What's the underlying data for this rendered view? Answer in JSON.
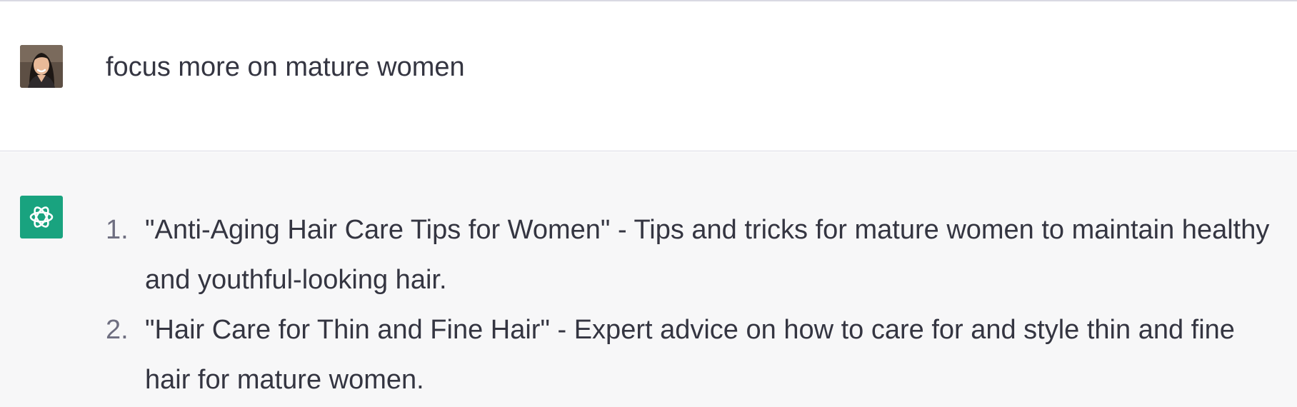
{
  "conversation": {
    "user_message": {
      "avatar_icon": "user-avatar-photo",
      "text": "focus more on mature women"
    },
    "assistant_message": {
      "avatar_icon": "openai-logo-icon",
      "avatar_color": "#19a37f",
      "items": [
        {
          "number": "1.",
          "text": "\"Anti-Aging Hair Care Tips for Women\" - Tips and tricks for mature women to maintain healthy and youthful-looking hair."
        },
        {
          "number": "2.",
          "text": "\"Hair Care for Thin and Fine Hair\" - Expert advice on how to care for and style thin and fine hair for mature women."
        }
      ]
    }
  },
  "colors": {
    "text": "#343541",
    "assistant_background": "#f7f7f8",
    "divider": "#d9d9e3"
  }
}
